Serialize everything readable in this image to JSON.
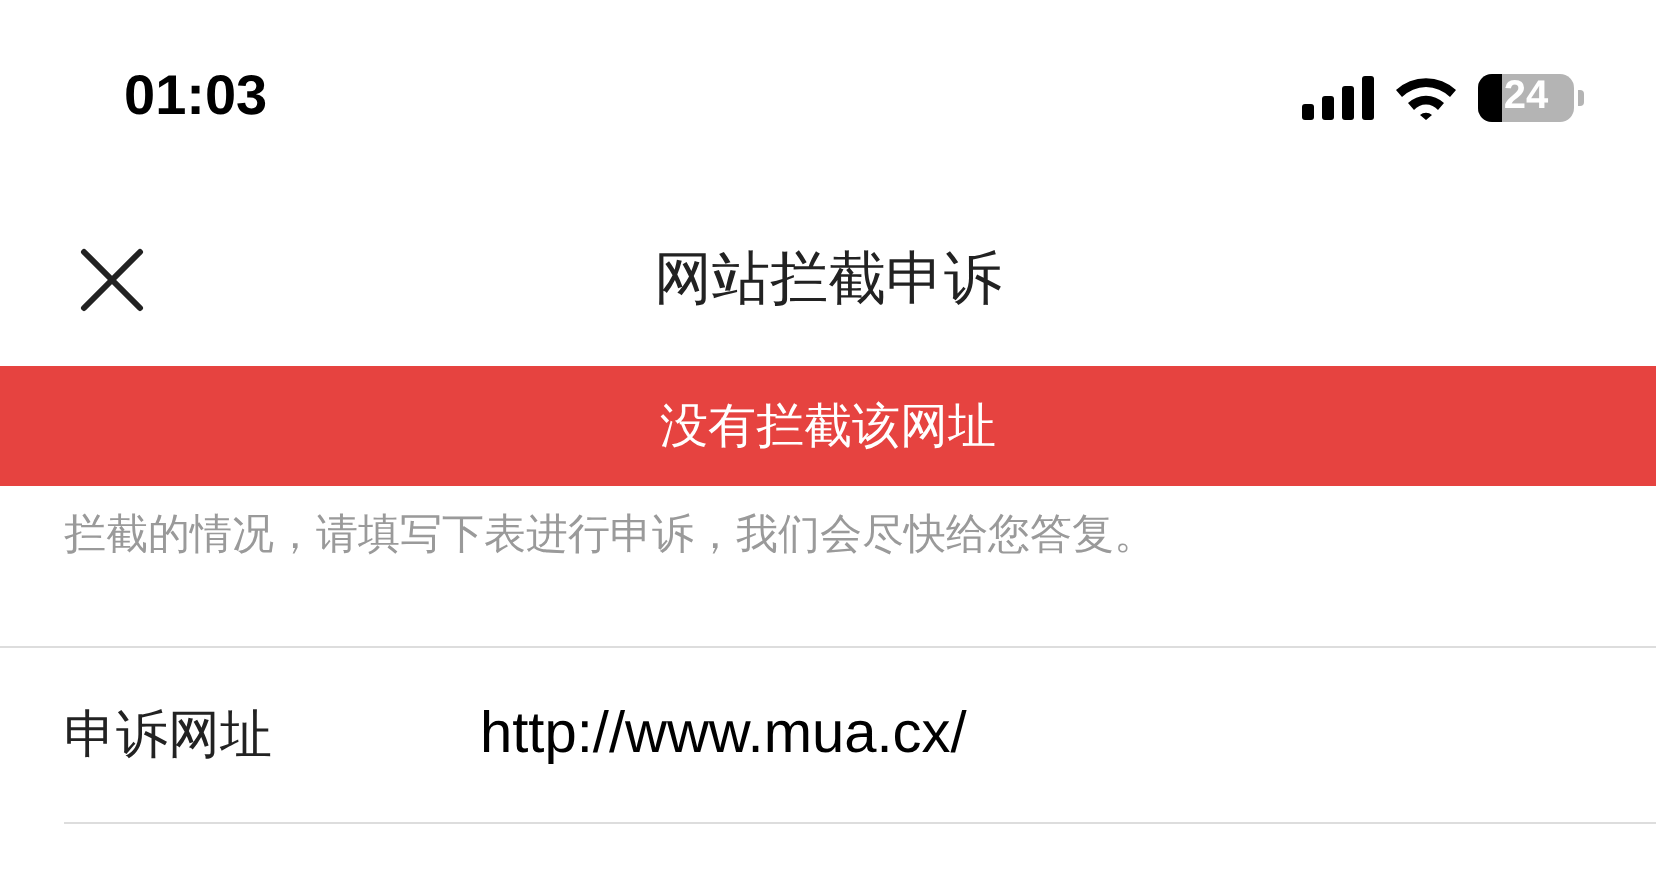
{
  "status_bar": {
    "time": "01:03",
    "battery": "24"
  },
  "nav": {
    "title": "网站拦截申诉"
  },
  "banner": {
    "text": "没有拦截该网址"
  },
  "description": "拦截的情况，请填写下表进行申诉，我们会尽快给您答复。",
  "form": [
    {
      "label": "申诉网址",
      "value": "http://www.mua.cx/"
    }
  ]
}
